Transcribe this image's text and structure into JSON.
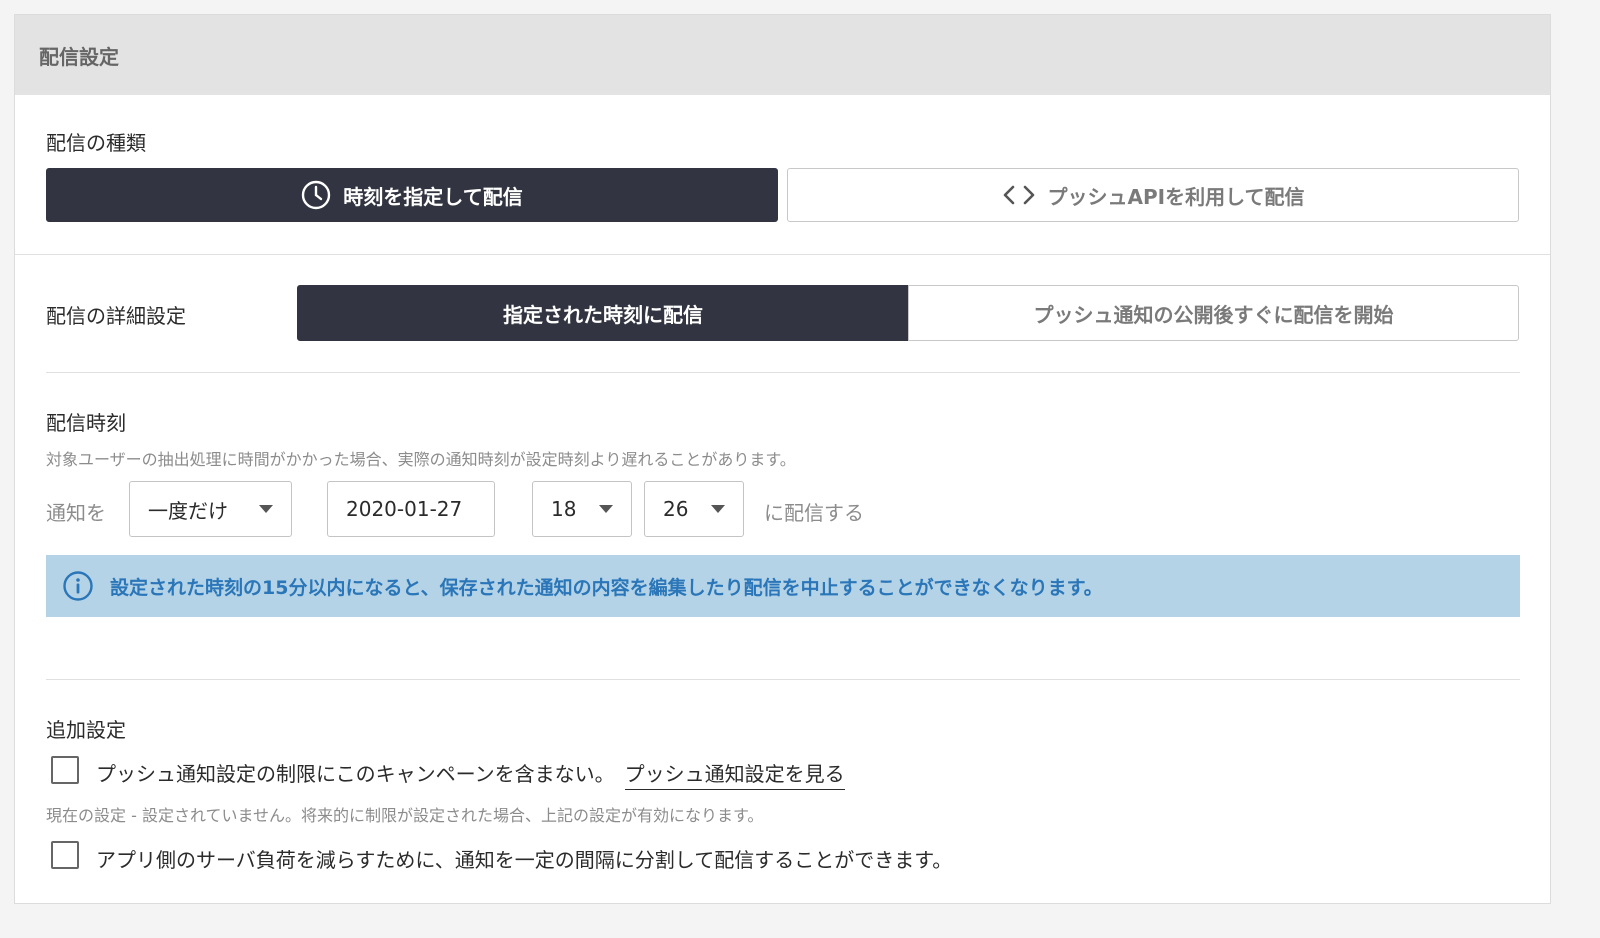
{
  "panel": {
    "title": "配信設定"
  },
  "delivery_type": {
    "label": "配信の種類",
    "options": [
      {
        "label": "時刻を指定して配信",
        "icon": "clock-icon",
        "selected": true
      },
      {
        "label": "プッシュAPIを利用して配信",
        "icon": "code-icon",
        "selected": false
      }
    ]
  },
  "detail": {
    "label": "配信の詳細設定",
    "options": [
      {
        "label": "指定された時刻に配信",
        "selected": true
      },
      {
        "label": "プッシュ通知の公開後すぐに配信を開始",
        "selected": false
      }
    ]
  },
  "time": {
    "label": "配信時刻",
    "hint": "対象ユーザーの抽出処理に時間がかかった場合、実際の通知時刻が設定時刻より遅れることがあります。",
    "prefix": "通知を",
    "frequency": "一度だけ",
    "date": "2020-01-27",
    "hour": "18",
    "minute": "26",
    "suffix": "に配信する"
  },
  "info": {
    "icon": "info-icon",
    "text": "設定された時刻の15分以内になると、保存された通知の内容を編集したり配信を中止することができなくなります。"
  },
  "additional": {
    "label": "追加設定",
    "opt1_text": "プッシュ通知設定の制限にこのキャンペーンを含まない。",
    "opt1_link": "プッシュ通知設定を見る",
    "opt1_checked": false,
    "current_setting": "現在の設定 - 設定されていません。将来的に制限が設定された場合、上記の設定が有効になります。",
    "opt2_text": "アプリ側のサーバ負荷を減らすために、通知を一定の間隔に分割して配信することができます。",
    "opt2_checked": false
  },
  "colors": {
    "active_bg": "#323541",
    "info_bg": "#b5d3e7",
    "info_text": "#2a76b8"
  }
}
